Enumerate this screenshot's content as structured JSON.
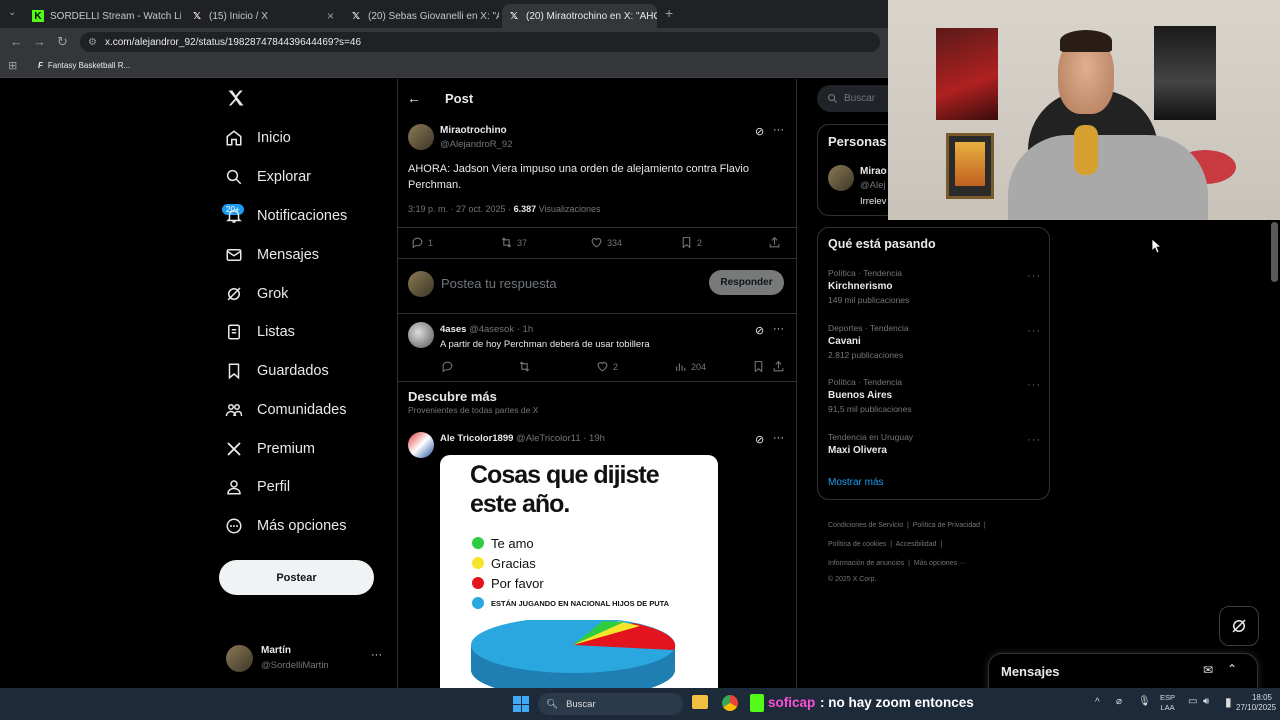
{
  "browser": {
    "tabs": [
      {
        "title": "SORDELLI Stream - Watch Live",
        "icon": "kick-icon"
      },
      {
        "title": "(15) Inicio / X",
        "icon": "x-icon"
      },
      {
        "title": "(20) Sebas Giovanelli en X: \"AH",
        "icon": "x-icon"
      },
      {
        "title": "(20) Miraotrochino en X: \"AHOR",
        "icon": "x-icon"
      }
    ],
    "url": "x.com/alejandror_92/status/1982874784439644469?s=46",
    "bookmark": "Fantasy Basketball R..."
  },
  "nav": {
    "items": [
      "Inicio",
      "Explorar",
      "Notificaciones",
      "Mensajes",
      "Grok",
      "Listas",
      "Guardados",
      "Comunidades",
      "Premium",
      "Perfil",
      "Más opciones"
    ],
    "notif_badge": "20+",
    "post_button": "Postear",
    "account": {
      "name": "Martín",
      "handle": "@SordelliMartin"
    }
  },
  "post": {
    "header": "Post",
    "author_name": "Miraotrochino",
    "author_handle": "@AlejandroR_92",
    "text": "AHORA: Jadson Viera impuso una orden de alejamiento contra Flavio Perchman.",
    "time": "3:19 p. m. · 27 oct. 2025 · ",
    "views": "6.387",
    "views_label": " Visualizaciones",
    "replies": "1",
    "reposts": "37",
    "likes": "334",
    "bookmarks": "2",
    "reply_placeholder": "Postea tu respuesta",
    "reply_button": "Responder"
  },
  "reply": {
    "name": "4ases",
    "handle": "@4asesok · 1h",
    "text": "A partir de hoy Perchman deberá de usar tobillera",
    "likes": "2",
    "views": "204"
  },
  "discover": {
    "title": "Descubre más",
    "subtitle": "Provenientes de todas partes de X",
    "post": {
      "name": "Ale Tricolor1899",
      "handle": "@AleTricolor11 · 19h",
      "image_title": "Cosas que dijiste este año.",
      "legend": [
        {
          "label": "Te amo",
          "color": "#2ecc40"
        },
        {
          "label": "Gracias",
          "color": "#f5e62b"
        },
        {
          "label": "Por favor",
          "color": "#e3141e"
        },
        {
          "label": "ESTÁN JUGANDO EN NACIONAL HIJOS DE PUTA",
          "color": "#2aa7df"
        }
      ]
    }
  },
  "right": {
    "search_placeholder": "Buscar",
    "people_title": "Personas",
    "people_name": "Mirao",
    "people_handle": "@Alej",
    "people_bio": "Irrelev",
    "trends_title": "Qué está pasando",
    "trends": [
      {
        "meta": "Política · Tendencia",
        "name": "Kirchnerismo",
        "count": "149 mil publicaciones"
      },
      {
        "meta": "Deportes · Tendencia",
        "name": "Cavani",
        "count": "2.812 publicaciones"
      },
      {
        "meta": "Política · Tendencia",
        "name": "Buenos Aires",
        "count": "91,5 mil publicaciones"
      },
      {
        "meta": "Tendencia en Uruguay",
        "name": "Maxi Olivera",
        "count": ""
      }
    ],
    "show_more": "Mostrar más",
    "footer": {
      "l1a": "Condiciones de Servicio",
      "l1b": "Política de Privacidad",
      "l2a": "Política de cookies",
      "l2b": "Accesibilidad",
      "l3a": "Información de anuncios",
      "l3b": "Más opciones ···",
      "copy": "© 2025 X Corp."
    },
    "messages": "Mensajes"
  },
  "taskbar": {
    "search": "Buscar",
    "chat_user": "soficap",
    "chat_msg": ": no hay zoom entonces",
    "lang": "ESP",
    "lang2": "LAA",
    "time": "18:05",
    "date": "27/10/2025"
  },
  "colors": {
    "accent": "#1d9bf0",
    "bg": "#000000",
    "border": "#2f3336"
  }
}
